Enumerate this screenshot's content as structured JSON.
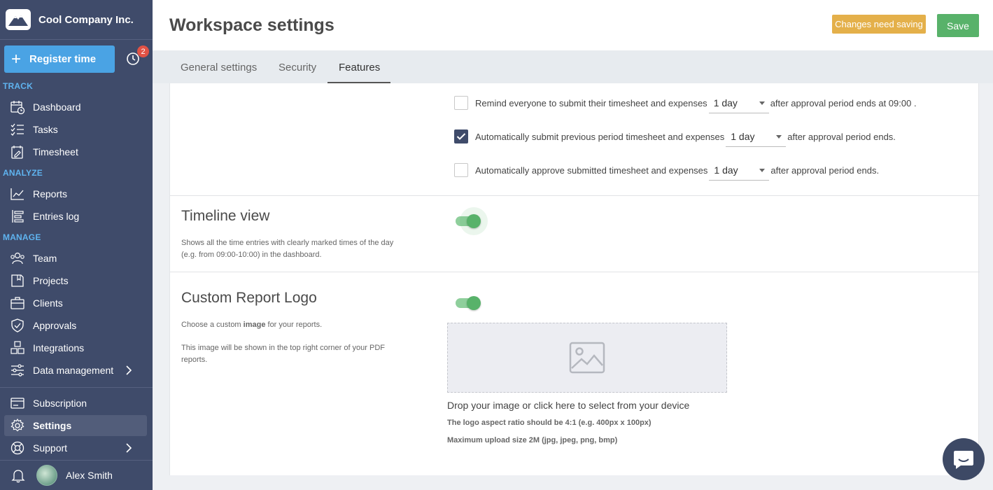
{
  "brand": {
    "name": "Cool Company Inc.",
    "logo_icon": "mountain-logo"
  },
  "register": {
    "label": "Register time",
    "notifications": "2"
  },
  "sidebar": {
    "sections": {
      "track": "TRACK",
      "analyze": "ANALYZE",
      "manage": "MANAGE"
    },
    "items": [
      {
        "label": "Dashboard",
        "icon": "calendar-clock-icon"
      },
      {
        "label": "Tasks",
        "icon": "checklist-icon"
      },
      {
        "label": "Timesheet",
        "icon": "timesheet-icon"
      },
      {
        "label": "Reports",
        "icon": "chart-line-icon"
      },
      {
        "label": "Entries log",
        "icon": "list-icon"
      },
      {
        "label": "Team",
        "icon": "team-icon"
      },
      {
        "label": "Projects",
        "icon": "folder-icon"
      },
      {
        "label": "Clients",
        "icon": "briefcase-icon"
      },
      {
        "label": "Approvals",
        "icon": "shield-check-icon"
      },
      {
        "label": "Integrations",
        "icon": "cubes-icon"
      },
      {
        "label": "Data management",
        "icon": "sliders-icon"
      },
      {
        "label": "Subscription",
        "icon": "card-icon"
      },
      {
        "label": "Settings",
        "icon": "gear-icon"
      },
      {
        "label": "Support",
        "icon": "lifebuoy-icon"
      }
    ],
    "active": "Settings"
  },
  "user": {
    "name": "Alex Smith"
  },
  "header": {
    "title": "Workspace settings",
    "warning": "Changes need saving",
    "save": "Save"
  },
  "tabs": [
    {
      "label": "General settings"
    },
    {
      "label": "Security"
    },
    {
      "label": "Features"
    }
  ],
  "approval_options": [
    {
      "checked": false,
      "before": "Remind everyone to submit their timesheet and expenses",
      "select": "1 day",
      "after": "after approval period ends at 09:00 ."
    },
    {
      "checked": true,
      "before": "Automatically submit previous period timesheet and expenses",
      "select": "1 day",
      "after": "after approval period ends."
    },
    {
      "checked": false,
      "before": "Automatically approve submitted timesheet and expenses",
      "select": "1 day",
      "after": "after approval period ends."
    }
  ],
  "timeline": {
    "title": "Timeline view",
    "description": "Shows all the time entries with clearly marked times of the day (e.g. from 09:00-10:00) in the dashboard.",
    "enabled": true
  },
  "report_logo": {
    "title": "Custom Report Logo",
    "desc_prefix": "Choose a custom ",
    "desc_bold": "image",
    "desc_suffix": " for your reports.",
    "desc2": "This image will be shown in the top right corner of your PDF reports.",
    "enabled": true,
    "drop_text": "Drop your image or click here to select from your device",
    "hint_ratio": "The logo aspect ratio should be 4:1 (e.g. 400px x 100px)",
    "hint_size": "Maximum upload size 2M (jpg, jpeg, png, bmp)"
  },
  "colors": {
    "sidebar": "#3f4b6a",
    "accent_blue": "#4aa3e4",
    "save_green": "#58b26a",
    "warning_yellow": "#e4b04a"
  }
}
